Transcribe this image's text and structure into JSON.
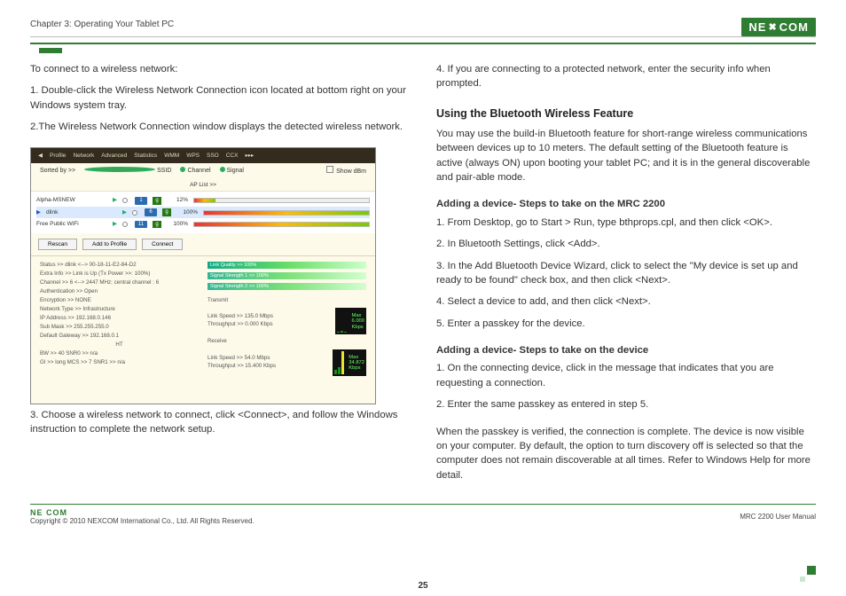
{
  "header": {
    "chapter": "Chapter 3: Operating Your Tablet PC",
    "brand": "NE",
    "brand2": "COM"
  },
  "left": {
    "intro": "To connect to a wireless network:",
    "step1": "1. Double-click the Wireless Network Connection icon located at bottom right on your Windows system tray.",
    "step2": "2.The Wireless Network Connection window displays the detected wireless network.",
    "step3": "3. Choose a wireless network to connect, click <Connect>, and follow the Windows instruction to complete the network setup."
  },
  "shot": {
    "tabs": [
      "Profile",
      "Network",
      "Advanced",
      "Statistics",
      "WMM",
      "WPS",
      "SSO",
      "CCX"
    ],
    "sort": "Sorted by >>",
    "col_ssid": "SSID",
    "col_channel": "Channel",
    "col_signal": "Signal",
    "show_dbm": "Show dBm",
    "ap_list": "AP List >>",
    "rows": [
      {
        "ssid": "Alpha-MSNEW",
        "ch": "1",
        "pct": "12%",
        "w": 12
      },
      {
        "ssid": "dlink",
        "ch": "6",
        "pct": "100%",
        "w": 100
      },
      {
        "ssid": "Free Public WiFi",
        "ch": "11",
        "pct": "100%",
        "w": 100
      }
    ],
    "btn_rescan": "Rescan",
    "btn_add": "Add to Profile",
    "btn_connect": "Connect",
    "details_left": [
      "Status >>   dlink <--> 00-18-11-E2-84-D2",
      "Extra Info >>   Link is Up (Tx Power >>: 100%)",
      "Channel >>   6 <--> 2447 MHz; central channel : 6",
      "Authentication >>   Open",
      "Encryption >>   NONE",
      "Network Type >>   Infrastructure",
      "IP Address >>   192.168.0.146",
      "Sub Mask >>   255.255.255.0",
      "Default Gateway >>   192.168.0.1",
      "HT",
      "BW >>  40                     SNR0 >>  n/a",
      "GI >>  long      MCS >>  7     SNR1 >>  n/a"
    ],
    "q1": "Link Quality >> 100%",
    "q2": "Signal Strength 1 >> 100%",
    "q3": "Signal Strength 2 >> 100%",
    "tx_label": "Transmit",
    "tx1": "Link Speed >> 135.0 Mbps",
    "tx2": "Throughput >> 0.000 Kbps",
    "tx_max": "Max\n6.000\nKbps",
    "rx_label": "Receive",
    "rx1": "Link Speed >> 54.0 Mbps",
    "rx2": "Throughput >> 15.400 Kbps",
    "rx_max": "Max\n34.872\nKbps"
  },
  "right": {
    "step4": "4. If you are connecting to a protected network, enter the security info when prompted.",
    "h_bt": "Using the Bluetooth Wireless Feature",
    "bt_intro": "You may use the build-in Bluetooth feature for short-range wireless communications between devices up to 10 meters.  The default setting of the Bluetooth feature is active (always ON) upon booting your tablet PC; and it is in the general discoverable and pair-able mode.",
    "h_add_mrc": "Adding a device- Steps to take on the MRC 2200",
    "mrc1": "1. From Desktop, go to Start > Run, type bthprops.cpl, and then click <OK>.",
    "mrc2": "2. In Bluetooth Settings, click <Add>.",
    "mrc3": "3. In the Add Bluetooth Device Wizard, click to select the \"My device is set up and ready to be found\" check box, and then click <Next>.",
    "mrc4": "4. Select a device to add, and then click <Next>.",
    "mrc5": "5. Enter a passkey for the device.",
    "h_add_dev": "Adding a device- Steps to take on the device",
    "dev1": "1. On the connecting device, click in the message that indicates that you are requesting a connection.",
    "dev2": "2. Enter the same passkey as entered in step 5.",
    "closing": "When the passkey is verified, the connection is complete. The device is now visible on your computer.  By default, the option to turn discovery off is selected so that the computer does not remain discoverable at all times. Refer to Windows Help for more detail."
  },
  "footer": {
    "copyright": "Copyright © 2010 NEXCOM International Co., Ltd. All Rights Reserved.",
    "page": "25",
    "doc": "MRC 2200 User Manual",
    "brand": "NE COM"
  }
}
